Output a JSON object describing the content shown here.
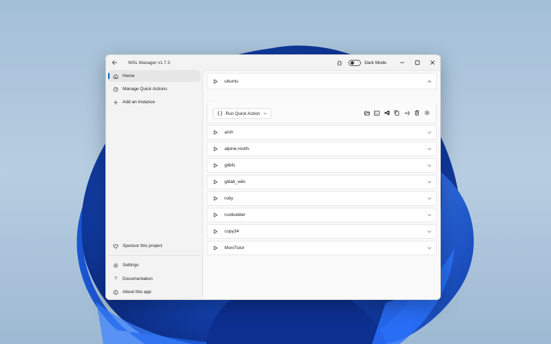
{
  "app": {
    "title": "WSL Manager v1.7.3",
    "dark_mode_label": "Dark Mode",
    "dark_mode_on": false
  },
  "sidebar": {
    "top_items": [
      {
        "label": "Home",
        "icon": "home-icon",
        "active": true
      },
      {
        "label": "Manage Quick Actions",
        "icon": "quick-actions-icon",
        "active": false
      },
      {
        "label": "Add an Instance",
        "icon": "plus-icon",
        "active": false
      }
    ],
    "sponsor": {
      "label": "Sponsor this project",
      "icon": "heart-icon"
    },
    "bottom_items": [
      {
        "label": "Settings",
        "icon": "gear-icon"
      },
      {
        "label": "Documentation",
        "icon": "question-icon"
      },
      {
        "label": "About this app",
        "icon": "info-icon"
      }
    ]
  },
  "instances": [
    {
      "name": "ubuntu",
      "expanded": true
    },
    {
      "name": "arch",
      "expanded": false
    },
    {
      "name": "alpine-rootfs",
      "expanded": false
    },
    {
      "name": "gitbfs",
      "expanded": false
    },
    {
      "name": "gitlab_wiki",
      "expanded": false
    },
    {
      "name": "ruby",
      "expanded": false
    },
    {
      "name": "rustbuilder",
      "expanded": false
    },
    {
      "name": "copy34",
      "expanded": false
    },
    {
      "name": "MoniTutor",
      "expanded": false
    }
  ],
  "expanded_panel": {
    "quick_action_label": "Run Quick Action",
    "action_icons": [
      "folder-open-icon",
      "terminal-icon",
      "vscode-icon",
      "copy-icon",
      "rename-icon",
      "delete-icon",
      "settings-icon"
    ]
  },
  "colors": {
    "accent": "#005fb8",
    "window_bg": "#f3f3f3",
    "card_bg": "#ffffff"
  }
}
